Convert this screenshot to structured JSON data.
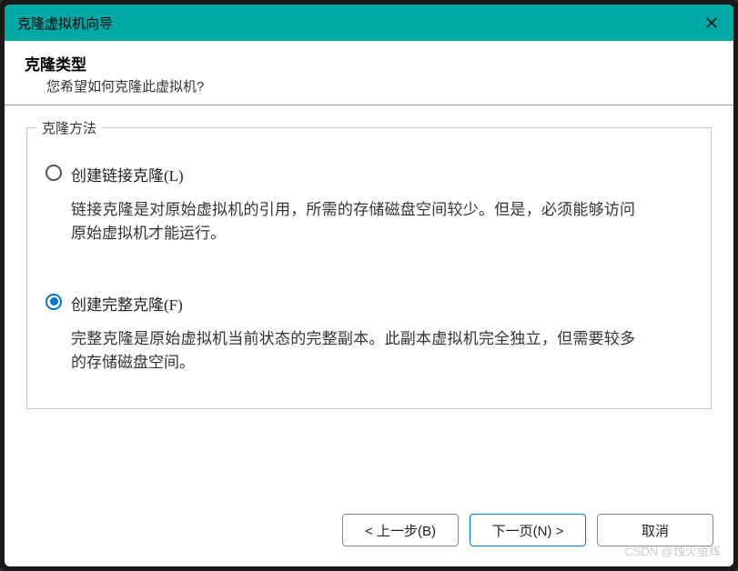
{
  "titlebar": {
    "title": "克隆虚拟机向导"
  },
  "header": {
    "title": "克隆类型",
    "subtitle": "您希望如何克隆此虚拟机?"
  },
  "fieldset": {
    "legend": "克隆方法",
    "options": [
      {
        "label": "创建链接克隆(L)",
        "desc": "链接克隆是对原始虚拟机的引用，所需的存储磁盘空间较少。但是，必须能够访问原始虚拟机才能运行。",
        "selected": false
      },
      {
        "label": "创建完整克隆(F)",
        "desc": "完整克隆是原始虚拟机当前状态的完整副本。此副本虚拟机完全独立，但需要较多的存储磁盘空间。",
        "selected": true
      }
    ]
  },
  "footer": {
    "back": "< 上一步(B)",
    "next": "下一页(N) >",
    "cancel": "取消"
  },
  "watermark": "CSDN @烛火萤辉"
}
